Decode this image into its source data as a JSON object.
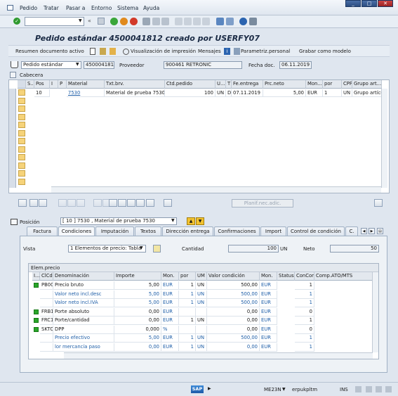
{
  "menu": {
    "items": [
      "Pedido",
      "Tratar",
      "Pasar a",
      "Entorno",
      "Sistema",
      "Ayuda"
    ]
  },
  "title": "Pedido estándar 4500041812 creado por USERFY07",
  "app_toolbar": {
    "summary": "Resumen documento activo",
    "print_preview": "Visualización de impresión",
    "messages": "Mensajes",
    "personal": "Parametriz.personal",
    "save_model": "Grabar como modelo"
  },
  "header": {
    "doc_type": "Pedido estándar",
    "doc_number": "4500041812",
    "vendor_label": "Proveedor",
    "vendor_value": "900461 RETRONIC",
    "date_label": "Fecha doc.",
    "date_value": "06.11.2019",
    "section": "Cabecera"
  },
  "items_grid": {
    "columns": [
      "S..",
      "Pos",
      "I",
      "P",
      "Material",
      "Txt.brv.",
      "Ctd.pedido",
      "U...",
      "T",
      "Fe.entrega",
      "Prc.neto",
      "Mon...",
      "por",
      "CPP",
      "Grupo art..."
    ],
    "rows": [
      {
        "pos": "10",
        "material": "7530",
        "text": "Material de prueba 7530",
        "qty": "100",
        "unit": "UN",
        "t": "D",
        "date": "07.11.2019",
        "price": "5,00",
        "curr": "EUR",
        "per": "1",
        "cpp": "UN",
        "group": "Grupo artícu"
      }
    ]
  },
  "plan_button": "Planif.nec.adic.",
  "position": {
    "label": "Posición",
    "value": "[ 10 ] 7530 , Material de prueba 7530"
  },
  "tabs": [
    "Factura",
    "Condiciones",
    "Imputación",
    "Textos",
    "Dirección entrega",
    "Confirmaciones",
    "Import",
    "Control de condición",
    "C."
  ],
  "conditions": {
    "view_label": "Vista",
    "view_value": "1 Elementos de precio: Tabla",
    "qty_label": "Cantidad",
    "qty_value": "100",
    "qty_unit": "UN",
    "net_label": "Neto",
    "net_value": "50",
    "grid_title": "Elem.precio",
    "columns": [
      "I...",
      "ClCd",
      "Denominación",
      "Importe",
      "Mon.",
      "por",
      "UM",
      "Valor condición",
      "Mon.",
      "Status",
      "ConCon",
      "Comp.ATO/MTS"
    ],
    "rows": [
      {
        "icon": "green",
        "code": "PB00",
        "name": "Precio bruto",
        "amount": "5,00",
        "curr": "EUR",
        "per": "1",
        "um": "UN",
        "value": "500,00",
        "vcurr": "EUR",
        "concon": "1",
        "blue": false
      },
      {
        "icon": "",
        "code": "",
        "name": "Valor neto incl.desc",
        "amount": "5,00",
        "curr": "EUR",
        "per": "1",
        "um": "UN",
        "value": "500,00",
        "vcurr": "EUR",
        "concon": "1",
        "blue": true
      },
      {
        "icon": "",
        "code": "",
        "name": "Valor neto incl.IVA",
        "amount": "5,00",
        "curr": "EUR",
        "per": "1",
        "um": "UN",
        "value": "500,00",
        "vcurr": "EUR",
        "concon": "1",
        "blue": true
      },
      {
        "icon": "green",
        "code": "FRB1",
        "name": "Porte absoluto",
        "amount": "0,00",
        "curr": "EUR",
        "per": "",
        "um": "",
        "value": "0,00",
        "vcurr": "EUR",
        "concon": "0",
        "blue": false
      },
      {
        "icon": "green",
        "code": "FRC1",
        "name": "Porte/cantidad",
        "amount": "0,00",
        "curr": "EUR",
        "per": "1",
        "um": "UN",
        "value": "0,00",
        "vcurr": "EUR",
        "concon": "1",
        "blue": false
      },
      {
        "icon": "green",
        "code": "SKTO",
        "name": "DPP",
        "amount": "0,000",
        "curr": "%",
        "per": "",
        "um": "",
        "value": "0,00",
        "vcurr": "EUR",
        "concon": "0",
        "blue": false
      },
      {
        "icon": "",
        "code": "",
        "name": "Precio efectivo",
        "amount": "5,00",
        "curr": "EUR",
        "per": "1",
        "um": "UN",
        "value": "500,00",
        "vcurr": "EUR",
        "concon": "1",
        "blue": true
      },
      {
        "icon": "",
        "code": "",
        "name": "lor mercancía paso",
        "amount": "0,00",
        "curr": "EUR",
        "per": "1",
        "um": "UN",
        "value": "0,00",
        "vcurr": "EUR",
        "concon": "1",
        "blue": true
      }
    ]
  },
  "status": {
    "brand": "SAP",
    "transaction": "ME23N",
    "server": "erpukpltm",
    "mode": "INS"
  }
}
